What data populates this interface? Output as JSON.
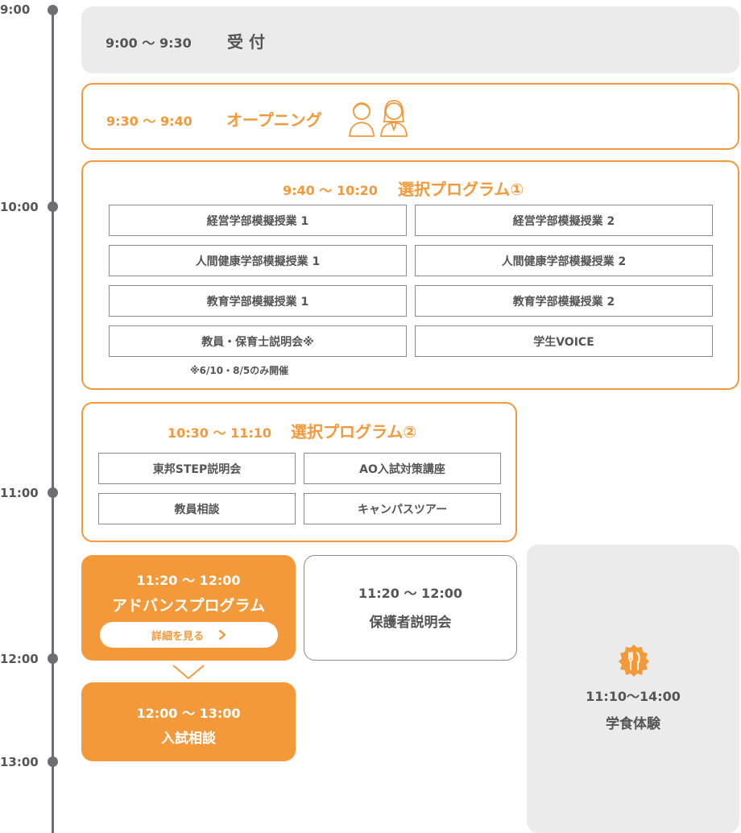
{
  "timeline": {
    "labels": [
      "9:00",
      "10:00",
      "11:00",
      "12:00",
      "13:00"
    ]
  },
  "reception": {
    "time": "9:00 〜 9:30",
    "title": "受 付"
  },
  "opening": {
    "time": "9:30 〜 9:40",
    "title": "オープニング",
    "icon": "people-icon"
  },
  "program1": {
    "time": "9:40 〜 10:20",
    "title": "選択プログラム①",
    "items": [
      "経営学部模擬授業 1",
      "経営学部模擬授業 2",
      "人間健康学部模擬授業 1",
      "人間健康学部模擬授業 2",
      "教育学部模擬授業 1",
      "教育学部模擬授業 2",
      "教員・保育士説明会※",
      "学生VOICE"
    ],
    "note": "※6/10・8/5のみ開催"
  },
  "program2": {
    "time": "10:30 〜 11:10",
    "title": "選択プログラム②",
    "items": [
      "東邦STEP説明会",
      "AO入試対策講座",
      "教員相談",
      "キャンパスツアー"
    ]
  },
  "advance": {
    "time": "11:20 〜 12:00",
    "title": "アドバンスプログラム",
    "button": "詳細を見る"
  },
  "parents": {
    "time": "11:20 〜 12:00",
    "title": "保護者説明会"
  },
  "consult": {
    "time": "12:00 〜 13:00",
    "title": "入試相談"
  },
  "cafeteria": {
    "time": "11:10〜14:00",
    "title": "学食体験",
    "icon": "fork-knife-icon"
  },
  "colors": {
    "accent": "#f3993a",
    "gray": "#ebebeb",
    "line": "#6b6f73"
  }
}
